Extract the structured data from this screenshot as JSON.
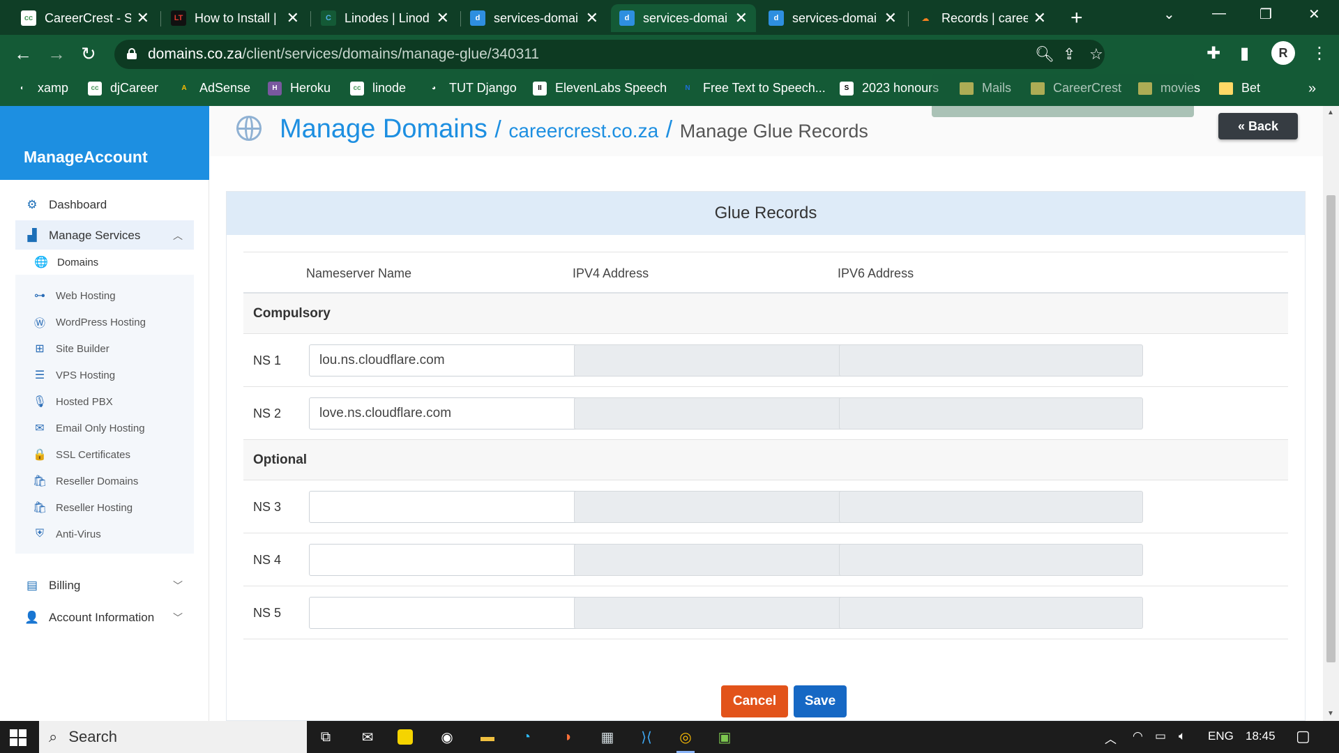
{
  "browser": {
    "tabs": [
      {
        "title": "CareerCrest - S",
        "fav": "cc",
        "fav_bg": "#ffffff",
        "fav_fg": "#4a9a5c"
      },
      {
        "title": "How to Install |",
        "fav": "LT",
        "fav_bg": "#111111",
        "fav_fg": "#e23b2e"
      },
      {
        "title": "Linodes | Linod",
        "fav": "C",
        "fav_bg": "#145a36",
        "fav_fg": "#4fb0e6"
      },
      {
        "title": "services-domai",
        "fav": "d",
        "fav_bg": "#2e8fe0",
        "fav_fg": "#ffffff"
      },
      {
        "title": "services-domai",
        "fav": "d",
        "fav_bg": "#2e8fe0",
        "fav_fg": "#ffffff"
      },
      {
        "title": "services-domai",
        "fav": "d",
        "fav_bg": "#2e8fe0",
        "fav_fg": "#ffffff"
      },
      {
        "title": "Records | caree",
        "fav": "☁",
        "fav_bg": "#0f3e26",
        "fav_fg": "#f48120"
      }
    ],
    "active_tab_index": 4,
    "url_host": "domains.co.za",
    "url_path": "/client/services/domains/manage-glue/340311",
    "bookmarks": [
      {
        "label": "xamp",
        "fav": "◐",
        "kind": "icon",
        "bg": "#145a36",
        "fg": "#ffffff"
      },
      {
        "label": "djCareer",
        "fav": "cc",
        "kind": "icon",
        "bg": "#ffffff",
        "fg": "#4a9a5c"
      },
      {
        "label": "AdSense",
        "fav": "A",
        "kind": "icon",
        "bg": "#145a36",
        "fg": "#fbbc04"
      },
      {
        "label": "Heroku",
        "fav": "H",
        "kind": "icon",
        "bg": "#79589f",
        "fg": "#ffffff"
      },
      {
        "label": "linode",
        "fav": "cc",
        "kind": "icon",
        "bg": "#ffffff",
        "fg": "#4a9a5c"
      },
      {
        "label": "TUT Django",
        "fav": "◕",
        "kind": "icon",
        "bg": "#145a36",
        "fg": "#ffffff"
      },
      {
        "label": "ElevenLabs Speech",
        "fav": "II",
        "kind": "icon",
        "bg": "#ffffff",
        "fg": "#000000"
      },
      {
        "label": "Free Text to Speech...",
        "fav": "N",
        "kind": "icon",
        "bg": "#145a36",
        "fg": "#1e6fd9"
      },
      {
        "label": "2023 honours",
        "fav": "S",
        "kind": "icon",
        "bg": "#ffffff",
        "fg": "#000000"
      },
      {
        "label": "Mails",
        "kind": "folder"
      },
      {
        "label": "CareerCrest",
        "kind": "folder"
      },
      {
        "label": "movies",
        "kind": "folder"
      },
      {
        "label": "Bet",
        "kind": "folder"
      }
    ]
  },
  "sidebar": {
    "brand": "ManageAccount",
    "items": [
      {
        "label": "Dashboard",
        "icon": "⚙"
      },
      {
        "label": "Manage Services",
        "icon": "▟"
      },
      {
        "label": "Billing",
        "icon": "▤"
      },
      {
        "label": "Account Information",
        "icon": "👤"
      }
    ],
    "sub_items": [
      {
        "label": "Domains",
        "icon": "🌐"
      },
      {
        "label": "Web Hosting",
        "icon": "⊶"
      },
      {
        "label": "WordPress Hosting",
        "icon": "Ⓦ"
      },
      {
        "label": "Site Builder",
        "icon": "⊞"
      },
      {
        "label": "VPS Hosting",
        "icon": "☰"
      },
      {
        "label": "Hosted PBX",
        "icon": "🎙"
      },
      {
        "label": "Email Only Hosting",
        "icon": "✉"
      },
      {
        "label": "SSL Certificates",
        "icon": "🔒"
      },
      {
        "label": "Reseller Domains",
        "icon": "🛍"
      },
      {
        "label": "Reseller Hosting",
        "icon": "🛍"
      },
      {
        "label": "Anti-Virus",
        "icon": "⛨"
      }
    ]
  },
  "header": {
    "crumb1": "Manage Domains",
    "sep": "/",
    "crumb2": "careercrest.co.za",
    "crumb3": "Manage Glue Records",
    "back_label": "« Back"
  },
  "card": {
    "title": "Glue Records",
    "columns": [
      "Nameserver Name",
      "IPV4 Address",
      "IPV6 Address"
    ],
    "groups": {
      "compulsory": "Compulsory",
      "optional": "Optional"
    },
    "rows": [
      {
        "label": "NS 1",
        "name": "lou.ns.cloudflare.com",
        "ipv4": "",
        "ipv6": ""
      },
      {
        "label": "NS 2",
        "name": "love.ns.cloudflare.com",
        "ipv4": "",
        "ipv6": ""
      },
      {
        "label": "NS 3",
        "name": "",
        "ipv4": "",
        "ipv6": ""
      },
      {
        "label": "NS 4",
        "name": "",
        "ipv4": "",
        "ipv6": ""
      },
      {
        "label": "NS 5",
        "name": "",
        "ipv4": "",
        "ipv6": ""
      }
    ],
    "cancel_label": "Cancel",
    "save_label": "Save"
  },
  "taskbar": {
    "search_label": "Search",
    "language": "ENG",
    "time": "18:45"
  },
  "colors": {
    "accent": "#1d8fe1",
    "chrome_frame": "#0f3e26",
    "chrome_toolbar": "#145a36",
    "cancel": "#e2531a",
    "save": "#1668c4"
  }
}
